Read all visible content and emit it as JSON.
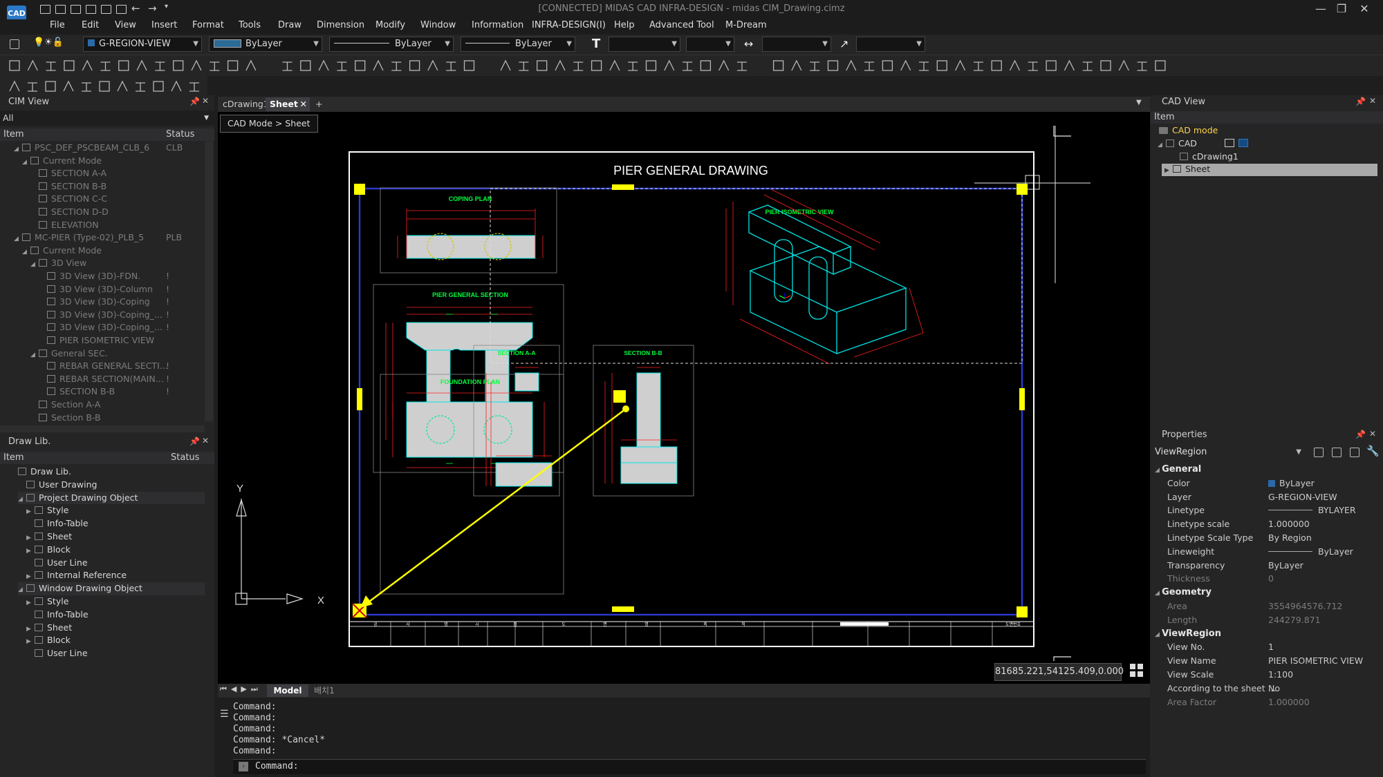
{
  "app": {
    "logo": "CAD",
    "window_title": "[CONNECTED] MIDAS CAD INFRA-DESIGN - midas CIM_Drawing.cimz",
    "minimize": "—",
    "maximize": "❐",
    "close": "✕"
  },
  "menu": [
    "File",
    "Edit",
    "View",
    "Insert",
    "Format",
    "Tools",
    "Draw",
    "Dimension",
    "Modify",
    "Window",
    "Information",
    "INFRA-DESIGN(I)",
    "Help",
    "Advanced Tool",
    "M-Dream"
  ],
  "toolbar": {
    "layer_value": "G-REGION-VIEW",
    "color_value": "ByLayer",
    "linetype_value": "ByLayer",
    "lineweight_value": "ByLayer"
  },
  "cim_view": {
    "title": "CIM View",
    "filter": "All",
    "col_item": "Item",
    "col_status": "Status",
    "rows": [
      {
        "label": "PSC_DEF_PSCBEAM_CLB_6",
        "status": "CLB"
      },
      {
        "label": "Current Mode",
        "status": ""
      },
      {
        "label": "SECTION A-A",
        "status": ""
      },
      {
        "label": "SECTION B-B",
        "status": ""
      },
      {
        "label": "SECTION C-C",
        "status": ""
      },
      {
        "label": "SECTION D-D",
        "status": ""
      },
      {
        "label": "ELEVATION",
        "status": ""
      },
      {
        "label": "MC-PIER (Type-02)_PLB_5",
        "status": "PLB"
      },
      {
        "label": "Current Mode",
        "status": ""
      },
      {
        "label": "3D View",
        "status": ""
      },
      {
        "label": "3D View (3D)-FDN.",
        "status": "!"
      },
      {
        "label": "3D View (3D)-Column",
        "status": "!"
      },
      {
        "label": "3D View (3D)-Coping",
        "status": "!"
      },
      {
        "label": "3D View (3D)-Coping_...",
        "status": "!"
      },
      {
        "label": "3D View (3D)-Coping_...",
        "status": "!"
      },
      {
        "label": "PIER ISOMETRIC VIEW",
        "status": ""
      },
      {
        "label": "General SEC.",
        "status": ""
      },
      {
        "label": "REBAR GENERAL SECTI...",
        "status": "!"
      },
      {
        "label": "REBAR SECTION(MAIN...",
        "status": "!"
      },
      {
        "label": "SECTION B-B",
        "status": "!"
      },
      {
        "label": "Section A-A",
        "status": ""
      },
      {
        "label": "Section B-B",
        "status": ""
      }
    ]
  },
  "draw_lib": {
    "title": "Draw Lib.",
    "col_item": "Item",
    "col_status": "Status",
    "rows": [
      "Draw Lib.",
      "User Drawing",
      "Project Drawing Object",
      "Style",
      "Info-Table",
      "Sheet",
      "Block",
      "User Line",
      "Internal Reference",
      "Window Drawing Object",
      "Style",
      "Info-Table",
      "Sheet",
      "Block",
      "User Line"
    ]
  },
  "doc_tabs": {
    "tab1": "cDrawing1",
    "tab2": "Sheet",
    "add": "+"
  },
  "breadcrumb": "CAD Mode > Sheet",
  "drawing": {
    "title": "PIER GENERAL DRAWING",
    "coping_plan": "COPING PLAN",
    "pier_general_section": "PIER GENERAL SECTION",
    "foundation_plan": "FOUNDATION PLAN",
    "pier_isometric_view": "PIER ISOMETRIC VIEW",
    "section_aa": "SECTION A-A",
    "section_bb": "SECTION B-B",
    "scale": "S=1:100",
    "axis_y": "Y",
    "axis_x": "X",
    "title_block_cells": [
      "공",
      "사",
      "명",
      "시",
      "점",
      "도",
      "면",
      "명",
      "축",
      "척",
      "도면번호"
    ]
  },
  "coords": "81685.221,54125.409,0.000",
  "layout_tabs": {
    "model": "Model",
    "layout1": "배치1"
  },
  "command": {
    "lines": [
      "Command:",
      "Command:",
      "Command:",
      "Command:  *Cancel*",
      "Command:"
    ],
    "prompt": "Command:"
  },
  "cad_view": {
    "title": "CAD View",
    "col_item": "Item",
    "rows": [
      "CAD mode",
      "CAD",
      "cDrawing1",
      "Sheet"
    ]
  },
  "properties": {
    "title": "Properties",
    "selector": "ViewRegion",
    "sections": {
      "general": "General",
      "geometry": "Geometry",
      "viewregion": "ViewRegion"
    },
    "general": [
      {
        "k": "Color",
        "v": "ByLayer"
      },
      {
        "k": "Layer",
        "v": "G-REGION-VIEW"
      },
      {
        "k": "Linetype",
        "v": "BYLAYER"
      },
      {
        "k": "Linetype scale",
        "v": "1.000000"
      },
      {
        "k": "Linetype Scale Type",
        "v": "By Region"
      },
      {
        "k": "Lineweight",
        "v": "ByLayer"
      },
      {
        "k": "Transparency",
        "v": "ByLayer"
      },
      {
        "k": "Thickness",
        "v": "0"
      }
    ],
    "geometry": [
      {
        "k": "Area",
        "v": "3554964576.712"
      },
      {
        "k": "Length",
        "v": "244279.871"
      }
    ],
    "viewregion": [
      {
        "k": "View No.",
        "v": "1"
      },
      {
        "k": "View Name",
        "v": "PIER ISOMETRIC VIEW"
      },
      {
        "k": "View Scale",
        "v": "1:100"
      },
      {
        "k": "According to the sheet ...",
        "v": "No"
      },
      {
        "k": "Area Factor",
        "v": "1.000000"
      }
    ]
  },
  "colors": {
    "accent": "#2a78c8",
    "region": "#1f2fa0",
    "grip": "#ffff00",
    "dim": "#ff2020",
    "struct": "#00e5e5",
    "label": "#00ff3c"
  }
}
